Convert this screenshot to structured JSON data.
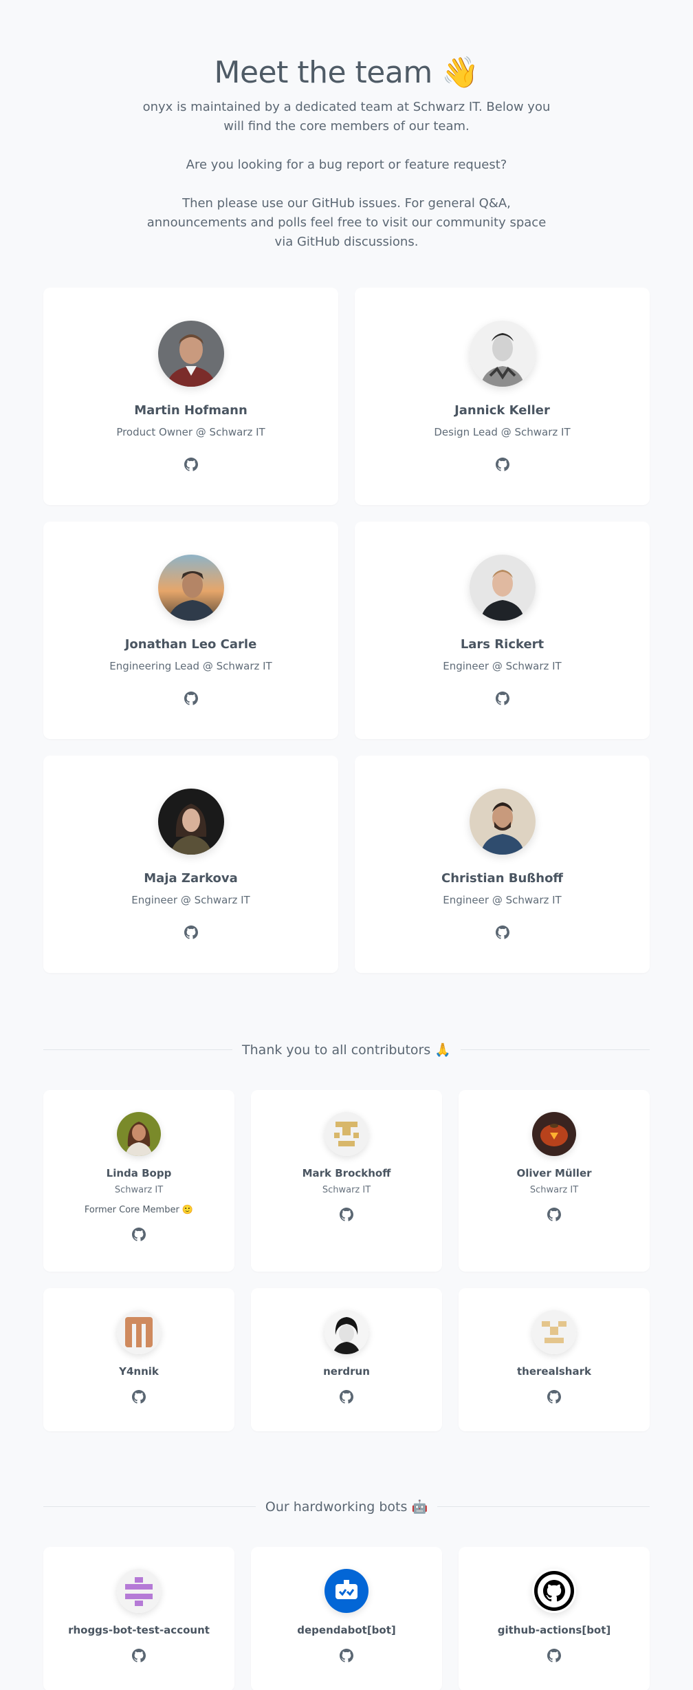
{
  "hero": {
    "title": "Meet the team",
    "title_emoji": "👋",
    "intro": "onyx is maintained by a dedicated team at Schwarz IT. Below you will find the core members of our team.",
    "question": "Are you looking for a bug report or feature request?",
    "tail": "Then please use our GitHub issues. For general Q&A, announcements and polls feel free to visit our community space via GitHub discussions."
  },
  "core_team": [
    {
      "name": "Martin Hofmann",
      "role": "Product Owner @ Schwarz IT",
      "icon": "github-icon"
    },
    {
      "name": "Jannick Keller",
      "role": "Design Lead @ Schwarz IT",
      "icon": "github-icon"
    },
    {
      "name": "Jonathan Leo Carle",
      "role": "Engineering Lead @ Schwarz IT",
      "icon": "github-icon"
    },
    {
      "name": "Lars Rickert",
      "role": "Engineer @ Schwarz IT",
      "icon": "github-icon"
    },
    {
      "name": "Maja Zarkova",
      "role": "Engineer @ Schwarz IT",
      "icon": "github-icon"
    },
    {
      "name": "Christian Bußhoff",
      "role": "Engineer @ Schwarz IT",
      "icon": "github-icon"
    }
  ],
  "contributors_section": {
    "title": "Thank you to all contributors",
    "emoji": "🙏"
  },
  "contributors": [
    {
      "name": "Linda Bopp",
      "org": "Schwarz IT",
      "note": "Former Core Member 🙂"
    },
    {
      "name": "Mark Brockhoff",
      "org": "Schwarz IT"
    },
    {
      "name": "Oliver Müller",
      "org": "Schwarz IT"
    },
    {
      "name": "Y4nnik"
    },
    {
      "name": "nerdrun"
    },
    {
      "name": "therealshark"
    }
  ],
  "bots_section": {
    "title": "Our hardworking bots",
    "emoji": "🤖"
  },
  "bots": [
    {
      "name": "rhoggs-bot-test-account"
    },
    {
      "name": "dependabot[bot]"
    },
    {
      "name": "github-actions[bot]"
    }
  ],
  "colors": {
    "background": "#f8f9fb",
    "card": "#ffffff",
    "text": "#4b5563",
    "identicon_gold": "#d8b76a",
    "identicon_purple": "#b57ad6",
    "identicon_orange": "#cf8a5e",
    "dependabot_blue": "#0366d6"
  }
}
